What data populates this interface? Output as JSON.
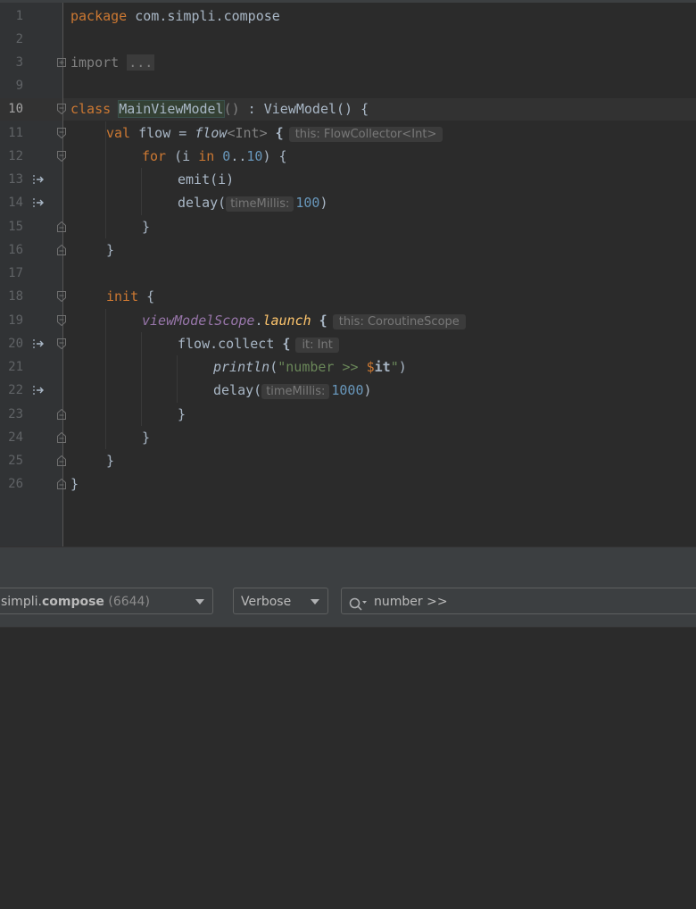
{
  "editor": {
    "current_line": "10",
    "line_numbers": [
      "1",
      "2",
      "3",
      "9",
      "10",
      "11",
      "12",
      "13",
      "14",
      "15",
      "16",
      "17",
      "18",
      "19",
      "20",
      "21",
      "22",
      "23",
      "24",
      "25",
      "26"
    ],
    "code": {
      "l1_kw": "package",
      "l1_rest": " com.simpli.compose",
      "l3_kw": "import",
      "l3_fold": "...",
      "l10_kw": "class",
      "l10_name": "MainViewModel",
      "l10_parens": "()",
      "l10_rest": " : ViewModel() {",
      "l11_kw": "val",
      "l11_var": " flow = ",
      "l11_fn": "flow",
      "l11_type": "<Int>",
      "l11_brace": " {",
      "l11_hint": "this: FlowCollector<Int>",
      "l12_kw": "for",
      "l12_a": " (i ",
      "l12_in": "in",
      "l12_num1": " 0",
      "l12_range": "..",
      "l12_num2": "10",
      "l12_b": ") {",
      "l13": "emit(i)",
      "l14_a": "delay(",
      "l14_hint": "timeMillis:",
      "l14_num": "100",
      "l14_b": ")",
      "l15": "}",
      "l16": "}",
      "l18_kw": "init",
      "l18_b": " {",
      "l19_scope": "viewModelScope",
      "l19_dot": ".",
      "l19_fn": "launch",
      "l19_brace": " {",
      "l19_hint": "this: CoroutineScope",
      "l20_a": "flow.collect",
      "l20_brace": " {",
      "l20_hint": "it: Int",
      "l21_fn": "println",
      "l21_a": "(",
      "l21_str": "\"number >> ",
      "l21_tmpl": "$",
      "l21_it": "it",
      "l21_str2": "\"",
      "l21_b": ")",
      "l22_a": "delay(",
      "l22_hint": "timeMillis:",
      "l22_num": "1000",
      "l22_b": ")",
      "l23": "}",
      "l24": "}",
      "l25": "}",
      "l26": "}"
    },
    "gutter_icons": [
      "suspend-call-icon",
      "suspend-call-icon",
      "suspend-call-icon",
      "suspend-call-icon"
    ]
  },
  "logcat": {
    "process_prefix": "simpli.",
    "process_bold": "compose",
    "process_pid": "(6644)",
    "log_level": "Verbose",
    "search_value": "number >>"
  },
  "colors": {
    "background": "#2b2b2b",
    "gutter": "#313335",
    "keyword": "#cc7832",
    "number": "#6897bb",
    "string": "#6a8759",
    "function": "#ffc66d"
  }
}
